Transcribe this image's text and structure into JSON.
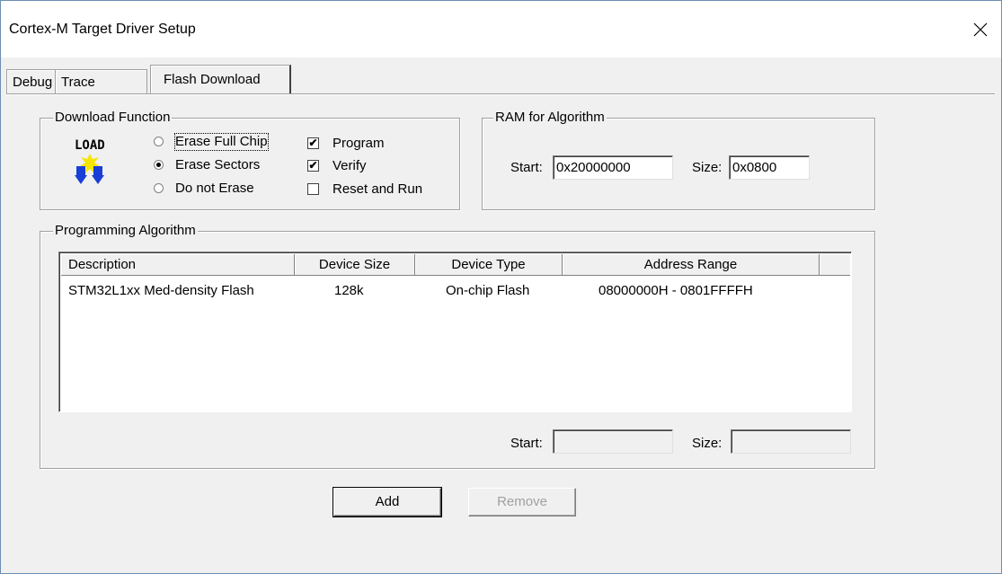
{
  "window": {
    "title": "Cortex-M Target Driver Setup"
  },
  "tabs": [
    {
      "label": "Debug",
      "active": false
    },
    {
      "label": "Trace",
      "active": false
    },
    {
      "label": "Flash Download",
      "active": true
    }
  ],
  "download_function": {
    "group_label": "Download Function",
    "icon_text": "LOAD",
    "radios": [
      {
        "label": "Erase Full Chip",
        "checked": false
      },
      {
        "label": "Erase Sectors",
        "checked": true
      },
      {
        "label": "Do not Erase",
        "checked": false
      }
    ],
    "checkboxes": [
      {
        "label": "Program",
        "checked": true
      },
      {
        "label": "Verify",
        "checked": true
      },
      {
        "label": "Reset and Run",
        "checked": false
      }
    ]
  },
  "ram_for_algorithm": {
    "group_label": "RAM for Algorithm",
    "start_label": "Start:",
    "start_value": "0x20000000",
    "size_label": "Size:",
    "size_value": "0x0800"
  },
  "programming_algorithm": {
    "group_label": "Programming Algorithm",
    "columns": [
      "Description",
      "Device Size",
      "Device Type",
      "Address Range"
    ],
    "rows": [
      [
        "STM32L1xx Med-density Flash",
        "128k",
        "On-chip Flash",
        "08000000H - 0801FFFFH"
      ]
    ],
    "start_label": "Start:",
    "start_value": "",
    "size_label": "Size:",
    "size_value": ""
  },
  "buttons": {
    "add": "Add",
    "remove": "Remove"
  },
  "colors": {
    "icon_blue": "#1a3fd6",
    "icon_yellow": "#f6e600"
  }
}
